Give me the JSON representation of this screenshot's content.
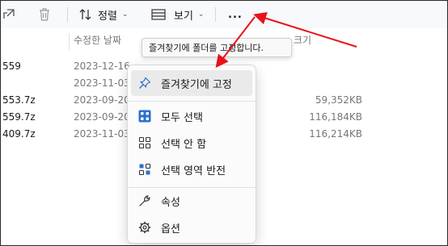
{
  "toolbar": {
    "sort_label": "정렬",
    "view_label": "보기",
    "more_label": "..."
  },
  "file_list": {
    "headers": {
      "date": "수정한 날짜",
      "size": "크기"
    },
    "rows": [
      {
        "name": "559",
        "date": "2023-12-16",
        "size": ""
      },
      {
        "name": "",
        "date": "2023-11-03",
        "size": ""
      },
      {
        "name": "553.7z",
        "date": "2023-09-20",
        "size": "59,352KB"
      },
      {
        "name": "559.7z",
        "date": "2023-09-20",
        "size": "116,184KB"
      },
      {
        "name": "409.7z",
        "date": "2023-11-03",
        "size": "116,214KB"
      }
    ]
  },
  "tooltip": {
    "text": "즐겨찾기에 폴더를 고정합니다."
  },
  "context_menu": {
    "items": [
      {
        "label": "즐겨찾기에 고정",
        "icon": "pin-icon"
      },
      {
        "label": "모두 선택",
        "icon": "select-all-icon"
      },
      {
        "label": "선택 안 함",
        "icon": "select-none-icon"
      },
      {
        "label": "선택 영역 반전",
        "icon": "invert-selection-icon"
      },
      {
        "label": "속성",
        "icon": "properties-icon"
      },
      {
        "label": "옵션",
        "icon": "options-gear-icon"
      }
    ]
  },
  "colors": {
    "accent": "#2b6fcf",
    "annotation": "#e8121b"
  }
}
